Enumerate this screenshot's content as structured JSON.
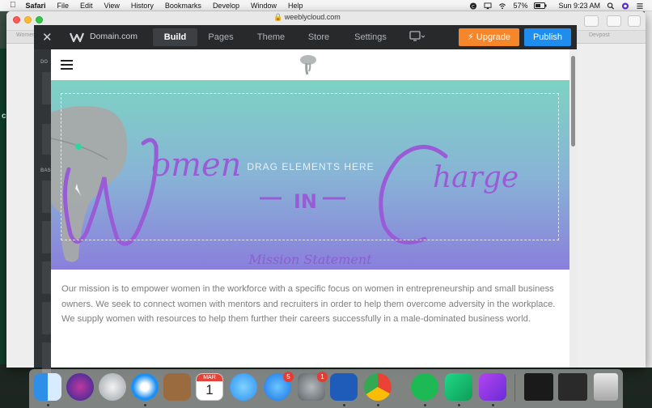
{
  "menubar": {
    "app_name": "Safari",
    "items": [
      "File",
      "Edit",
      "View",
      "History",
      "Bookmarks",
      "Develop",
      "Window",
      "Help"
    ],
    "battery": "57%",
    "clock": "Sun 9:23 AM"
  },
  "browser": {
    "url": "weeblycloud.com",
    "tab_left": "Womer",
    "tab_right": "Devpost"
  },
  "desktop": {
    "frag_c": "c",
    "frag_tr": "Tr"
  },
  "editor": {
    "domain": "Domain.com",
    "tabs": [
      {
        "label": "Build",
        "active": true
      },
      {
        "label": "Pages",
        "active": false
      },
      {
        "label": "Theme",
        "active": false
      },
      {
        "label": "Store",
        "active": false
      },
      {
        "label": "Settings",
        "active": false
      }
    ],
    "upgrade_label": "Upgrade",
    "publish_label": "Publish",
    "sidebar_frag_1": "DO",
    "sidebar_frag_2": "BAS"
  },
  "page": {
    "drop_text": "DRAG ELEMENTS HERE",
    "mission_title": "Mission Statement",
    "body": "Our mission is to empower women in the workforce with a specific focus on women in entrepreneurship and small business owners. We seek to connect women with mentors and recruiters in order to help them overcome adversity in the workplace. We supply women with resources to help them further their careers successfully in a male-dominated business world."
  },
  "dock": {
    "calendar_month": "MAR",
    "calendar_day": "1",
    "appstore_badge": "5",
    "prefs_badge": "1"
  },
  "colors": {
    "upgrade": "#f5862a",
    "publish": "#1f8ded",
    "banner_script": "#9a5cd6",
    "mission": "#8b5fd0"
  }
}
